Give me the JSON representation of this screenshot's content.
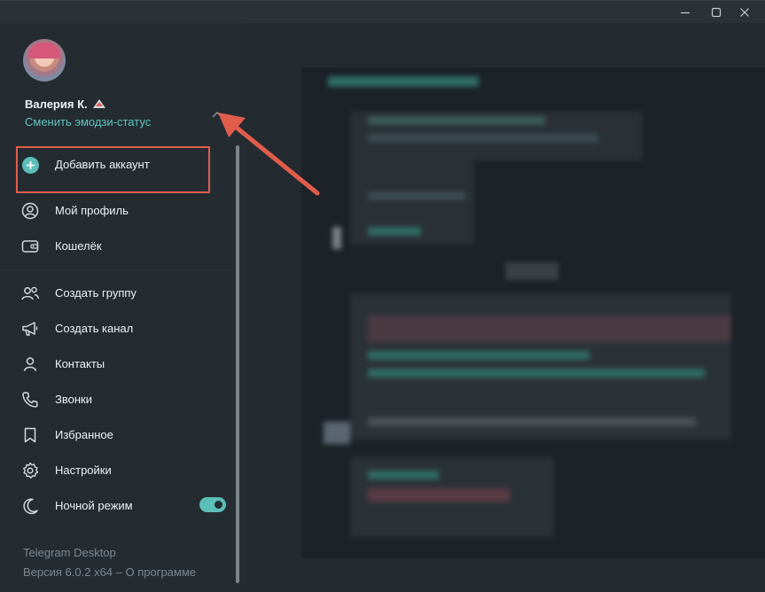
{
  "window": {
    "minimize_icon": "minimize-icon",
    "maximize_icon": "maximize-icon",
    "close_icon": "close-icon"
  },
  "profile": {
    "name": "Валерия К.",
    "emoji_status_link": "Сменить эмодзи-статус"
  },
  "menu": {
    "add_account": "Добавить аккаунт",
    "my_profile": "Мой профиль",
    "wallet": "Кошелёк",
    "create_group": "Создать группу",
    "create_channel": "Создать канал",
    "contacts": "Контакты",
    "calls": "Звонки",
    "saved": "Избранное",
    "settings": "Настройки",
    "night_mode": "Ночной режим"
  },
  "night_mode_enabled": true,
  "footer": {
    "app_name": "Telegram Desktop",
    "version": "Версия 6.0.2 x64 – О программе"
  },
  "colors": {
    "accent": "#5bbeb8",
    "highlight_border": "#e05d4c",
    "sidebar_bg": "#242c32"
  }
}
